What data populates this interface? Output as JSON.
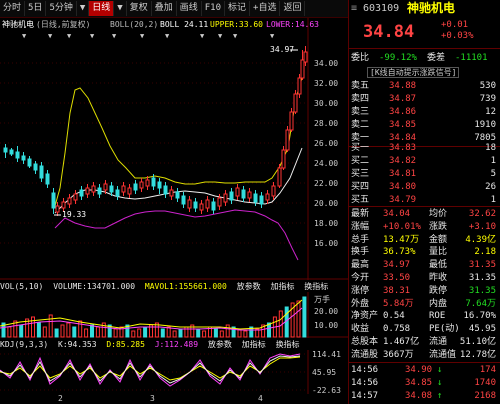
{
  "toolbar": {
    "items": [
      "分时",
      "5日",
      "5分钟",
      "▼",
      "日线",
      "▼",
      "复权",
      "叠加",
      "画线",
      "F10",
      "标记",
      "+自选",
      "返回"
    ],
    "active_index": 4
  },
  "legend": {
    "name": "神驰机电",
    "period": "(日线,前复权)",
    "boll_label": "BOLL(20,2)",
    "boll_val": "BOLL 24.11",
    "upper": "UPPER:33.60",
    "lower": "LOWER:14.63"
  },
  "price_axis": [
    "34.00",
    "32.00",
    "30.00",
    "28.00",
    "26.00",
    "24.00",
    "22.00",
    "20.00",
    "18.00",
    "16.00"
  ],
  "price_labels": {
    "high": "34.97",
    "low": "19.33"
  },
  "vol_panel": {
    "label": "VOL(5,10)",
    "volume": "VOLUME:134701.000",
    "mavol1": "MAVOL1:155661.000",
    "btn1": "放参数",
    "btn2": "加指标",
    "btn3": "换指标",
    "axis": [
      "万手",
      "20.00",
      "10.00"
    ]
  },
  "kdj_panel": {
    "label": "KDJ(9,3,3)",
    "k": "K:94.353",
    "d": "D:85.285",
    "j": "J:112.489",
    "btn1": "放参数",
    "btn2": "加指标",
    "btn3": "换指标",
    "axis": [
      "114.41",
      "45.95",
      "-22.63"
    ]
  },
  "month_labels": [
    "2",
    "3",
    "4"
  ],
  "right_panel": {
    "code": "603109",
    "name": "神驰机电",
    "price": "34.84",
    "change": "+0.01",
    "change_pct": "+0.03%",
    "weibi_label": "委比",
    "weibi": "-99.12%",
    "weicha_label": "委差",
    "weicha": "-11101",
    "banner": "[K线自动提示涨跌信号]",
    "asks": [
      {
        "label": "卖五",
        "price": "34.88",
        "vol": "530"
      },
      {
        "label": "卖四",
        "price": "34.87",
        "vol": "739"
      },
      {
        "label": "卖三",
        "price": "34.86",
        "vol": "12"
      },
      {
        "label": "卖二",
        "price": "34.85",
        "vol": "1910"
      },
      {
        "label": "卖一",
        "price": "34.84",
        "vol": "7805"
      }
    ],
    "bids": [
      {
        "label": "买一",
        "price": "34.83",
        "vol": "18"
      },
      {
        "label": "买二",
        "price": "34.82",
        "vol": "1"
      },
      {
        "label": "买三",
        "price": "34.81",
        "vol": "5"
      },
      {
        "label": "买四",
        "price": "34.80",
        "vol": "26"
      },
      {
        "label": "买五",
        "price": "34.79",
        "vol": "1"
      }
    ],
    "stats": [
      {
        "l1": "最新",
        "v1": "34.04",
        "c1": "red",
        "l2": "均价",
        "v2": "32.62",
        "c2": "red"
      },
      {
        "l1": "涨幅",
        "v1": "+10.01%",
        "c1": "red",
        "l2": "涨跌",
        "v2": "+3.10",
        "c2": "red"
      },
      {
        "l1": "总手",
        "v1": "13.47万",
        "c1": "yellow",
        "l2": "金额",
        "v2": "4.39亿",
        "c2": "yellow"
      },
      {
        "l1": "换手",
        "v1": "36.73%",
        "c1": "yellow",
        "l2": "量比",
        "v2": "2.18",
        "c2": "yellow"
      },
      {
        "l1": "最高",
        "v1": "34.97",
        "c1": "red",
        "l2": "最低",
        "v2": "31.35",
        "c2": "red"
      },
      {
        "l1": "今开",
        "v1": "33.50",
        "c1": "red",
        "l2": "昨收",
        "v2": "31.35",
        "c2": "white"
      },
      {
        "l1": "涨停",
        "v1": "38.31",
        "c1": "red",
        "l2": "跌停",
        "v2": "31.35",
        "c2": "green"
      },
      {
        "l1": "外盘",
        "v1": "5.84万",
        "c1": "red",
        "l2": "内盘",
        "v2": "7.64万",
        "c2": "green"
      },
      {
        "l1": "净资产",
        "v1": "0.54",
        "c1": "white",
        "l2": "ROE",
        "v2": "16.70%",
        "c2": "white"
      },
      {
        "l1": "收益",
        "v1": "0.758",
        "c1": "white",
        "l2": "PE(动)",
        "v2": "45.95",
        "c2": "white"
      },
      {
        "l1": "总股本",
        "v1": "1.467亿",
        "c1": "white",
        "l2": "流通",
        "v2": "51.10亿",
        "c2": "white"
      },
      {
        "l1": "流通股",
        "v1": "3667万",
        "c1": "white",
        "l2": "流通值",
        "v2": "12.78亿",
        "c2": "white"
      }
    ],
    "ticks": [
      {
        "time": "14:56",
        "price": "34.90",
        "arrow": "↓",
        "vol": "174"
      },
      {
        "time": "14:56",
        "price": "34.85",
        "arrow": "↓",
        "vol": "1740"
      },
      {
        "time": "14:57",
        "price": "34.08",
        "arrow": "↑",
        "vol": "2168"
      }
    ]
  }
}
